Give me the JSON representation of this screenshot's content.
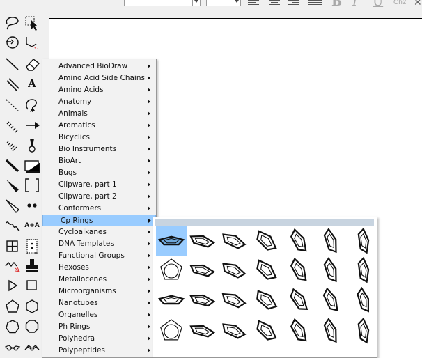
{
  "window": {
    "format_bar": {
      "caption_label": "Ch2"
    }
  },
  "palette": {
    "text_tool_label": "A",
    "aa_tool_label": "A+A"
  },
  "template_menu": {
    "items": [
      {
        "label": "Advanced BioDraw",
        "highlighted": false
      },
      {
        "label": "Amino Acid Side Chains",
        "highlighted": false
      },
      {
        "label": "Amino Acids",
        "highlighted": false
      },
      {
        "label": "Anatomy",
        "highlighted": false
      },
      {
        "label": "Animals",
        "highlighted": false
      },
      {
        "label": "Aromatics",
        "highlighted": false
      },
      {
        "label": "Bicyclics",
        "highlighted": false
      },
      {
        "label": "Bio Instruments",
        "highlighted": false
      },
      {
        "label": "BioArt",
        "highlighted": false
      },
      {
        "label": "Bugs",
        "highlighted": false
      },
      {
        "label": "Clipware, part 1",
        "highlighted": false
      },
      {
        "label": "Clipware, part 2",
        "highlighted": false
      },
      {
        "label": "Conformers",
        "highlighted": false
      },
      {
        "label": "Cp Rings",
        "highlighted": true
      },
      {
        "label": "Cycloalkanes",
        "highlighted": false
      },
      {
        "label": "DNA Templates",
        "highlighted": false
      },
      {
        "label": "Functional Groups",
        "highlighted": false
      },
      {
        "label": "Hexoses",
        "highlighted": false
      },
      {
        "label": "Metallocenes",
        "highlighted": false
      },
      {
        "label": "Microorganisms",
        "highlighted": false
      },
      {
        "label": "Nanotubes",
        "highlighted": false
      },
      {
        "label": "Organelles",
        "highlighted": false
      },
      {
        "label": "Ph Rings",
        "highlighted": false
      },
      {
        "label": "Polyhedra",
        "highlighted": false
      },
      {
        "label": "Polypeptides",
        "highlighted": false
      }
    ]
  },
  "cp_rings_gallery": {
    "rows": 4,
    "columns": 7,
    "selected_index": 0,
    "highlight_color": "#99ccff"
  }
}
